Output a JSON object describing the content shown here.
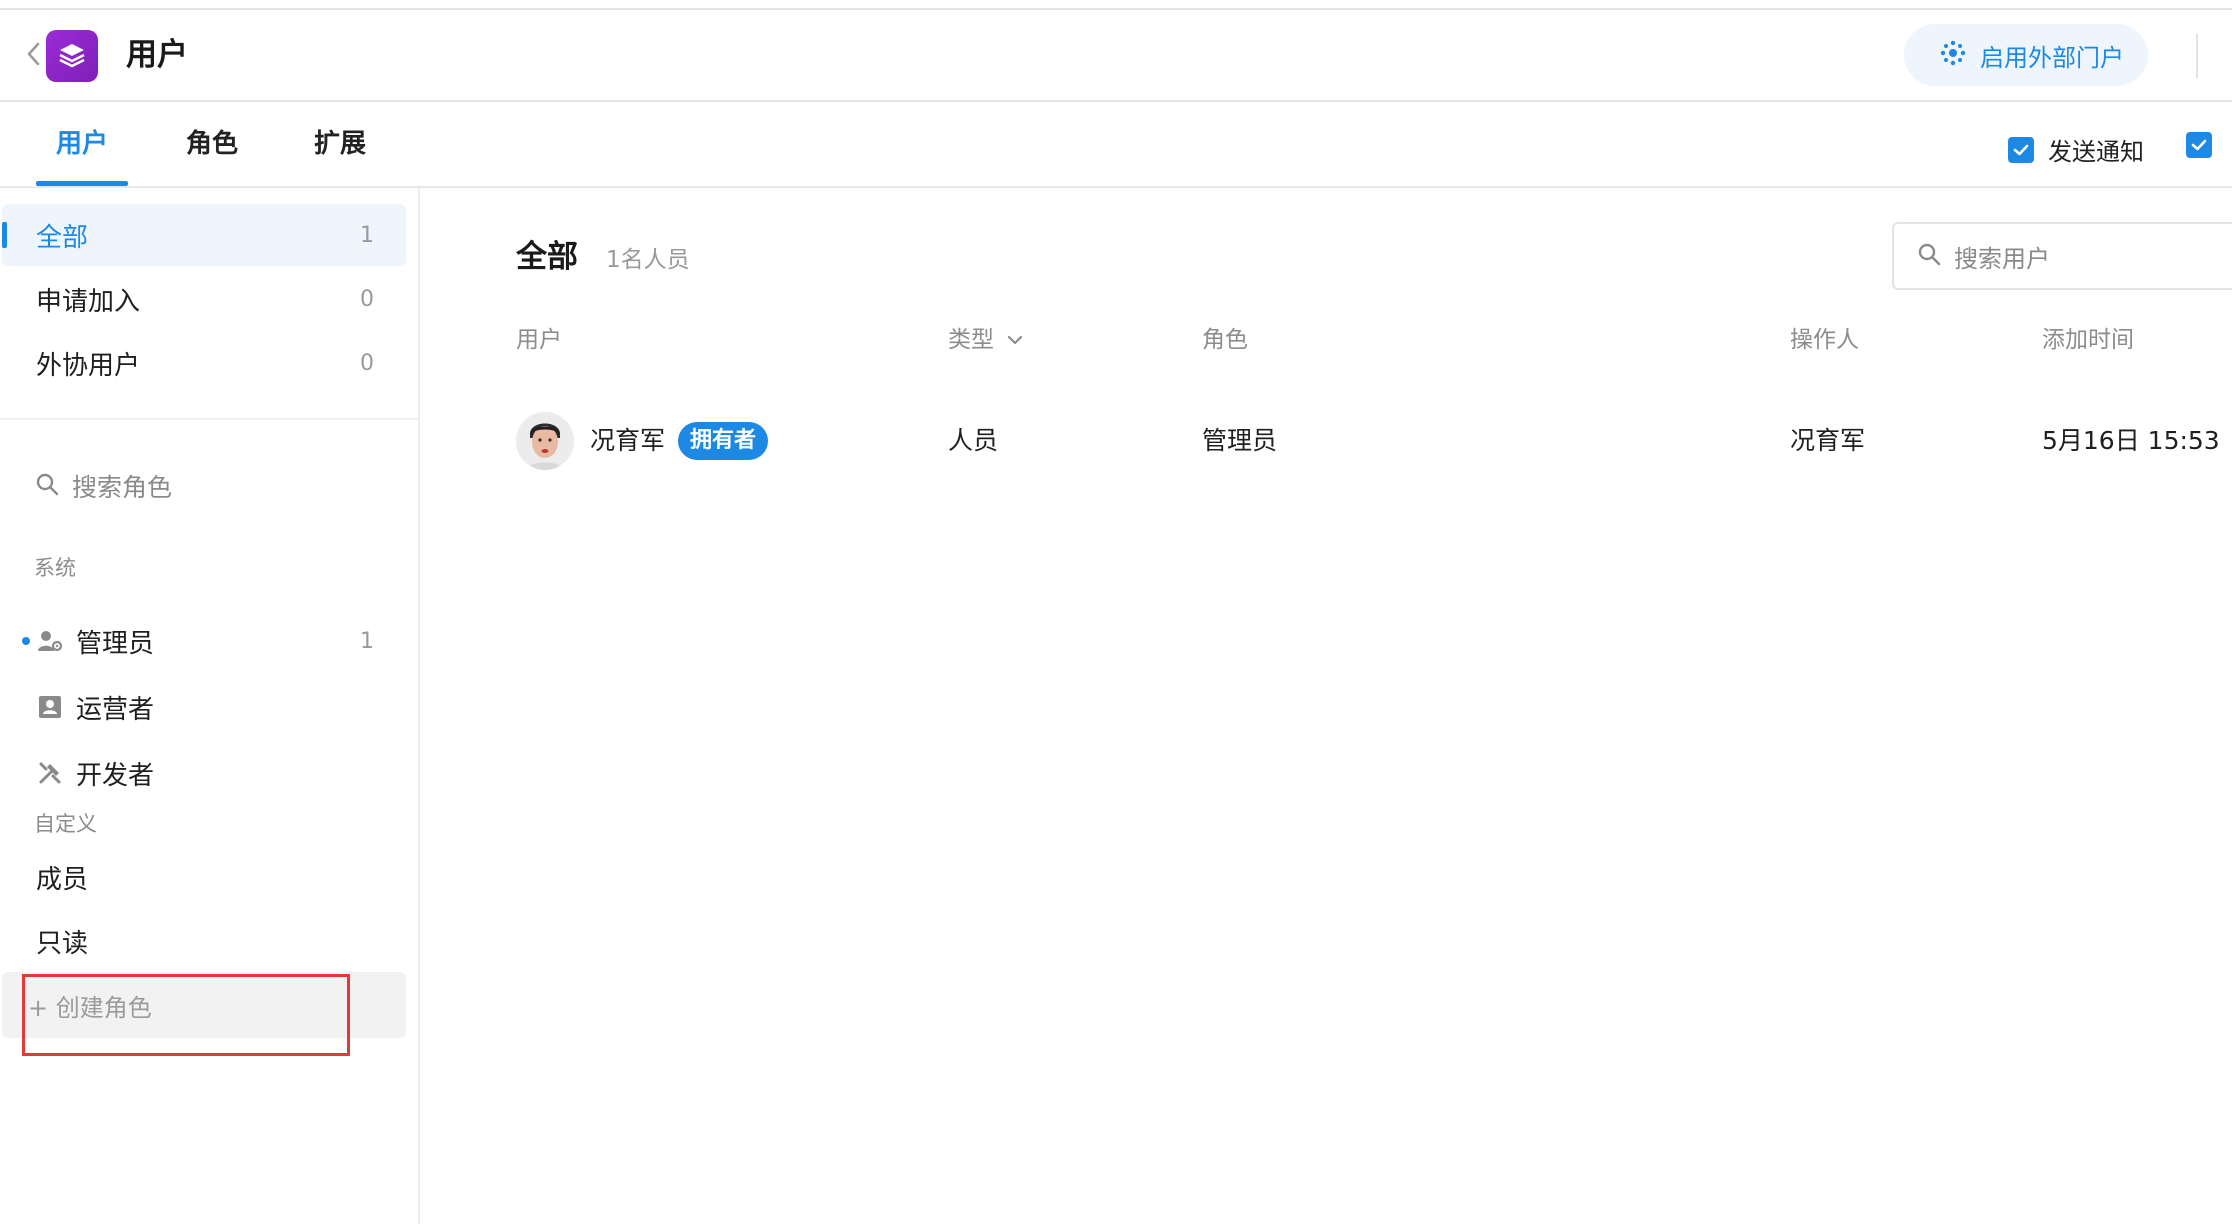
{
  "app": {
    "title": "用户",
    "portal_button": "启用外部门户"
  },
  "tabs": [
    {
      "label": "用户",
      "active": true
    },
    {
      "label": "角色",
      "active": false
    },
    {
      "label": "扩展",
      "active": false
    }
  ],
  "options": {
    "send_notification": {
      "label": "发送通知",
      "checked": true
    },
    "second_checkbox": {
      "checked": true
    }
  },
  "sidebar": {
    "filters": [
      {
        "label": "全部",
        "count": "1",
        "active": true
      },
      {
        "label": "申请加入",
        "count": "0",
        "active": false
      },
      {
        "label": "外协用户",
        "count": "0",
        "active": false
      }
    ],
    "role_search_placeholder": "搜索角色",
    "system_title": "系统",
    "system_roles": [
      {
        "label": "管理员",
        "count": "1",
        "icon": "admin-users-icon",
        "has_dot": true
      },
      {
        "label": "运营者",
        "icon": "id-card-icon"
      },
      {
        "label": "开发者",
        "icon": "tools-icon"
      }
    ],
    "custom_title": "自定义",
    "custom_roles": [
      {
        "label": "成员"
      },
      {
        "label": "只读"
      }
    ],
    "create_role": "+ 创建角色"
  },
  "main": {
    "title": "全部",
    "count_text": "1名人员",
    "search_placeholder": "搜索用户",
    "columns": [
      "用户",
      "类型",
      "角色",
      "操作人",
      "添加时间"
    ],
    "rows": [
      {
        "user": "况育军",
        "badge": "拥有者",
        "type": "人员",
        "role": "管理员",
        "operator": "况育军",
        "added": "5月16日 15:53"
      }
    ]
  },
  "colors": {
    "accent": "#1e88e5",
    "app_logo": "#9b2bd6",
    "highlight": "#e53935"
  }
}
